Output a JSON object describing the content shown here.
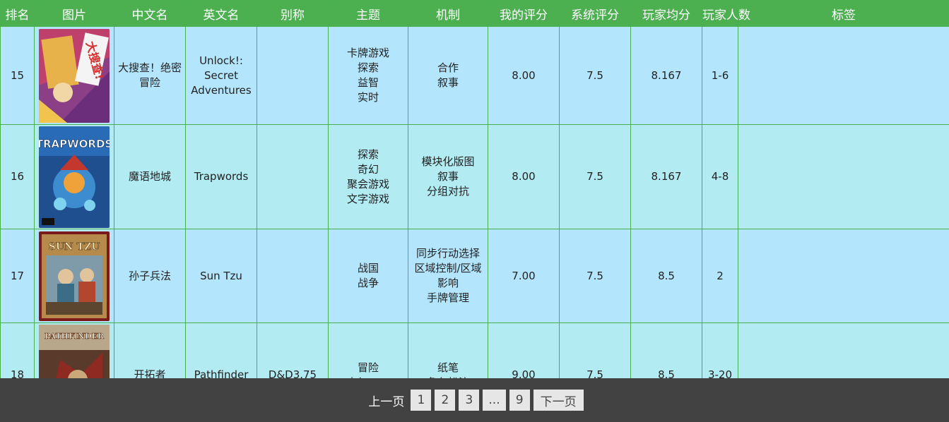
{
  "columns": [
    "排名",
    "图片",
    "中文名",
    "英文名",
    "别称",
    "主题",
    "机制",
    "我的评分",
    "系统评分",
    "玩家均分",
    "玩家人数",
    "标签"
  ],
  "rows": [
    {
      "rank": "15",
      "cover_icon": "unlock-secret-adventures-cover",
      "cover_title": "大搜查!",
      "cn_name": "大搜查！绝密冒险",
      "en_name": "Unlock!: Secret Adventures",
      "alias": "",
      "themes": [
        "卡牌游戏",
        "探索",
        "益智",
        "实时"
      ],
      "mechanics": [
        "合作",
        "叙事"
      ],
      "my_score": "8.00",
      "sys_score": "7.5",
      "avg_score": "8.167",
      "players": "1-6",
      "tags": ""
    },
    {
      "rank": "16",
      "cover_icon": "trapwords-cover",
      "cover_title": "TRAPWORDS",
      "cn_name": "魔语地城",
      "en_name": "Trapwords",
      "alias": "",
      "themes": [
        "探索",
        "奇幻",
        "聚会游戏",
        "文字游戏"
      ],
      "mechanics": [
        "模块化版图",
        "叙事",
        "分组对抗"
      ],
      "my_score": "8.00",
      "sys_score": "7.5",
      "avg_score": "8.167",
      "players": "4-8",
      "tags": ""
    },
    {
      "rank": "17",
      "cover_icon": "sun-tzu-cover",
      "cover_title": "SUN TZU",
      "cn_name": "孙子兵法",
      "en_name": "Sun Tzu",
      "alias": "",
      "themes": [
        "战国",
        "战争"
      ],
      "mechanics": [
        "同步行动选择",
        "区域控制/区域影响",
        "手牌管理"
      ],
      "my_score": "7.00",
      "sys_score": "7.5",
      "avg_score": "8.5",
      "players": "2",
      "tags": ""
    },
    {
      "rank": "18",
      "cover_icon": "pathfinder-cover",
      "cover_title": "PATHFINDER",
      "cn_name": "开拓者",
      "en_name": "Pathfinder",
      "alias": "D&D3.75",
      "themes": [
        "冒险",
        "奇幻RPG"
      ],
      "mechanics": [
        "纸笔",
        "角色扮演"
      ],
      "my_score": "9.00",
      "sys_score": "7.5",
      "avg_score": "8.5",
      "players": "3-20",
      "tags": ""
    }
  ],
  "pagination": {
    "prev_label": "上一页",
    "pages": [
      "1",
      "2",
      "3",
      "...",
      "9"
    ],
    "next_label": "下一页"
  },
  "colors": {
    "header_bg": "#4caf50",
    "row_a": "#b3e5fc",
    "row_b": "#b2ebf2",
    "border": "#49b04f",
    "pager_bg": "#424242"
  }
}
